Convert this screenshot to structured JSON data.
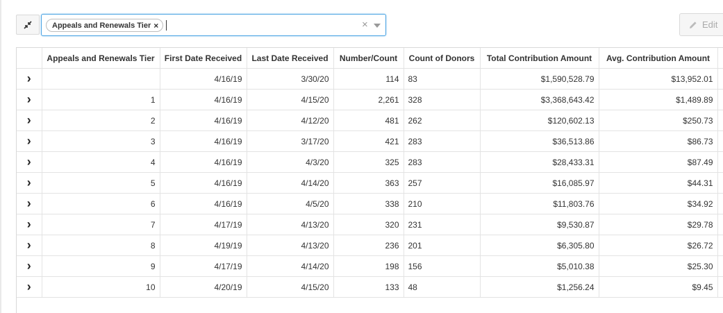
{
  "filter": {
    "chip_label": "Appeals and Renewals Tier",
    "chip_remove": "×",
    "clear": "×"
  },
  "edit_label": "Edit",
  "icons": {
    "collapse": "collapse-arrows-icon",
    "edit": "pencil-icon",
    "expand": "chevron-right-icon"
  },
  "table": {
    "headers": [
      "Appeals and Renewals Tier",
      "First Date Received",
      "Last Date Received",
      "Number/Count",
      "Count of Donors",
      "Total Contribution Amount",
      "Avg. Contribution Amount"
    ],
    "rows": [
      [
        "",
        "4/16/19",
        "3/30/20",
        "114",
        "83",
        "$1,590,528.79",
        "$13,952.01"
      ],
      [
        "1",
        "4/16/19",
        "4/15/20",
        "2,261",
        "328",
        "$3,368,643.42",
        "$1,489.89"
      ],
      [
        "2",
        "4/16/19",
        "4/12/20",
        "481",
        "262",
        "$120,602.13",
        "$250.73"
      ],
      [
        "3",
        "4/16/19",
        "3/17/20",
        "421",
        "283",
        "$36,513.86",
        "$86.73"
      ],
      [
        "4",
        "4/16/19",
        "4/3/20",
        "325",
        "283",
        "$28,433.31",
        "$87.49"
      ],
      [
        "5",
        "4/16/19",
        "4/14/20",
        "363",
        "257",
        "$16,085.97",
        "$44.31"
      ],
      [
        "6",
        "4/16/19",
        "4/5/20",
        "338",
        "210",
        "$11,803.76",
        "$34.92"
      ],
      [
        "7",
        "4/17/19",
        "4/13/20",
        "320",
        "231",
        "$9,530.87",
        "$29.78"
      ],
      [
        "8",
        "4/19/19",
        "4/13/20",
        "236",
        "201",
        "$6,305.80",
        "$26.72"
      ],
      [
        "9",
        "4/17/19",
        "4/14/20",
        "198",
        "156",
        "$5,010.38",
        "$25.30"
      ],
      [
        "10",
        "4/20/19",
        "4/15/20",
        "133",
        "48",
        "$1,256.24",
        "$9.45"
      ]
    ]
  }
}
